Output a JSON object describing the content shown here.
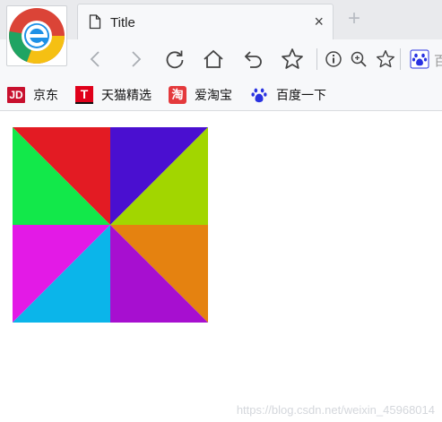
{
  "browser": {
    "tab": {
      "title": "Title",
      "close_glyph": "×"
    },
    "new_tab_glyph": "+",
    "logo_icon": "browser-logo-icon",
    "toolbar": {
      "buttons": [
        "back-arrow-icon",
        "forward-arrow-icon",
        "reload-icon",
        "home-icon",
        "undo-icon",
        "bookmark-star-icon",
        "info-icon",
        "zoom-icon",
        "favorite-star-icon",
        "baidu-paw-icon"
      ],
      "trailing_text": "百"
    },
    "bookmarks": [
      {
        "badge": "JD",
        "label": "京东",
        "color": "#c8102e"
      },
      {
        "badge": "T",
        "label": "天猫精选",
        "color": "#e0001a"
      },
      {
        "badge": "淘",
        "label": "爱淘宝",
        "color": "#e4393c"
      },
      {
        "badge": "",
        "label": "百度一下",
        "color": "#2932e1"
      }
    ]
  },
  "content": {
    "triangle_colors": {
      "top_left_upper": "#e31b23",
      "top_left_lower": "#12e84a",
      "top_right_upper": "#4a0fd0",
      "top_right_lower": "#a2d600",
      "bottom_left_upper": "#e31ae6",
      "bottom_left_lower": "#0bb5ea",
      "bottom_right_upper": "#e58210",
      "bottom_right_lower": "#a70fd0"
    },
    "watermark": "https://blog.csdn.net/weixin_45968014"
  }
}
